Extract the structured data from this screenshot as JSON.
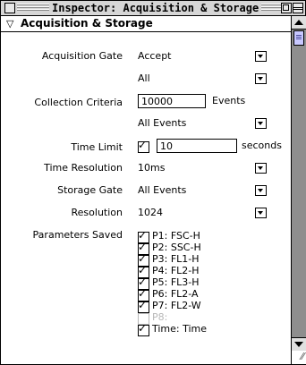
{
  "window": {
    "title": "Inspector: Acquisition & Storage"
  },
  "section": {
    "header": "Acquisition & Storage",
    "expanded_icon": "disclosure-triangle-down-icon"
  },
  "acquisition_gate": {
    "label": "Acquisition Gate",
    "value": "Accept",
    "value2": "All"
  },
  "collection_criteria": {
    "label": "Collection Criteria",
    "count": "10000",
    "unit": "Events",
    "events_value": "All Events"
  },
  "time_limit": {
    "label": "Time Limit",
    "checked": true,
    "value": "10",
    "unit": "seconds"
  },
  "time_resolution": {
    "label": "Time Resolution",
    "value": "10ms"
  },
  "storage_gate": {
    "label": "Storage Gate",
    "value": "All Events"
  },
  "resolution": {
    "label": "Resolution",
    "value": "1024"
  },
  "parameters_saved": {
    "label": "Parameters Saved",
    "items": [
      {
        "label": "P1: FSC-H",
        "checked": true,
        "enabled": true
      },
      {
        "label": "P2: SSC-H",
        "checked": true,
        "enabled": true
      },
      {
        "label": "P3: FL1-H",
        "checked": true,
        "enabled": true
      },
      {
        "label": "P4: FL2-H",
        "checked": true,
        "enabled": true
      },
      {
        "label": "P5: FL3-H",
        "checked": true,
        "enabled": true
      },
      {
        "label": "P6: FL2-A",
        "checked": true,
        "enabled": true
      },
      {
        "label": "P7: FL2-W",
        "checked": true,
        "enabled": true
      },
      {
        "label": "P8:",
        "checked": false,
        "enabled": false
      },
      {
        "label": "Time: Time",
        "checked": true,
        "enabled": true
      }
    ]
  }
}
